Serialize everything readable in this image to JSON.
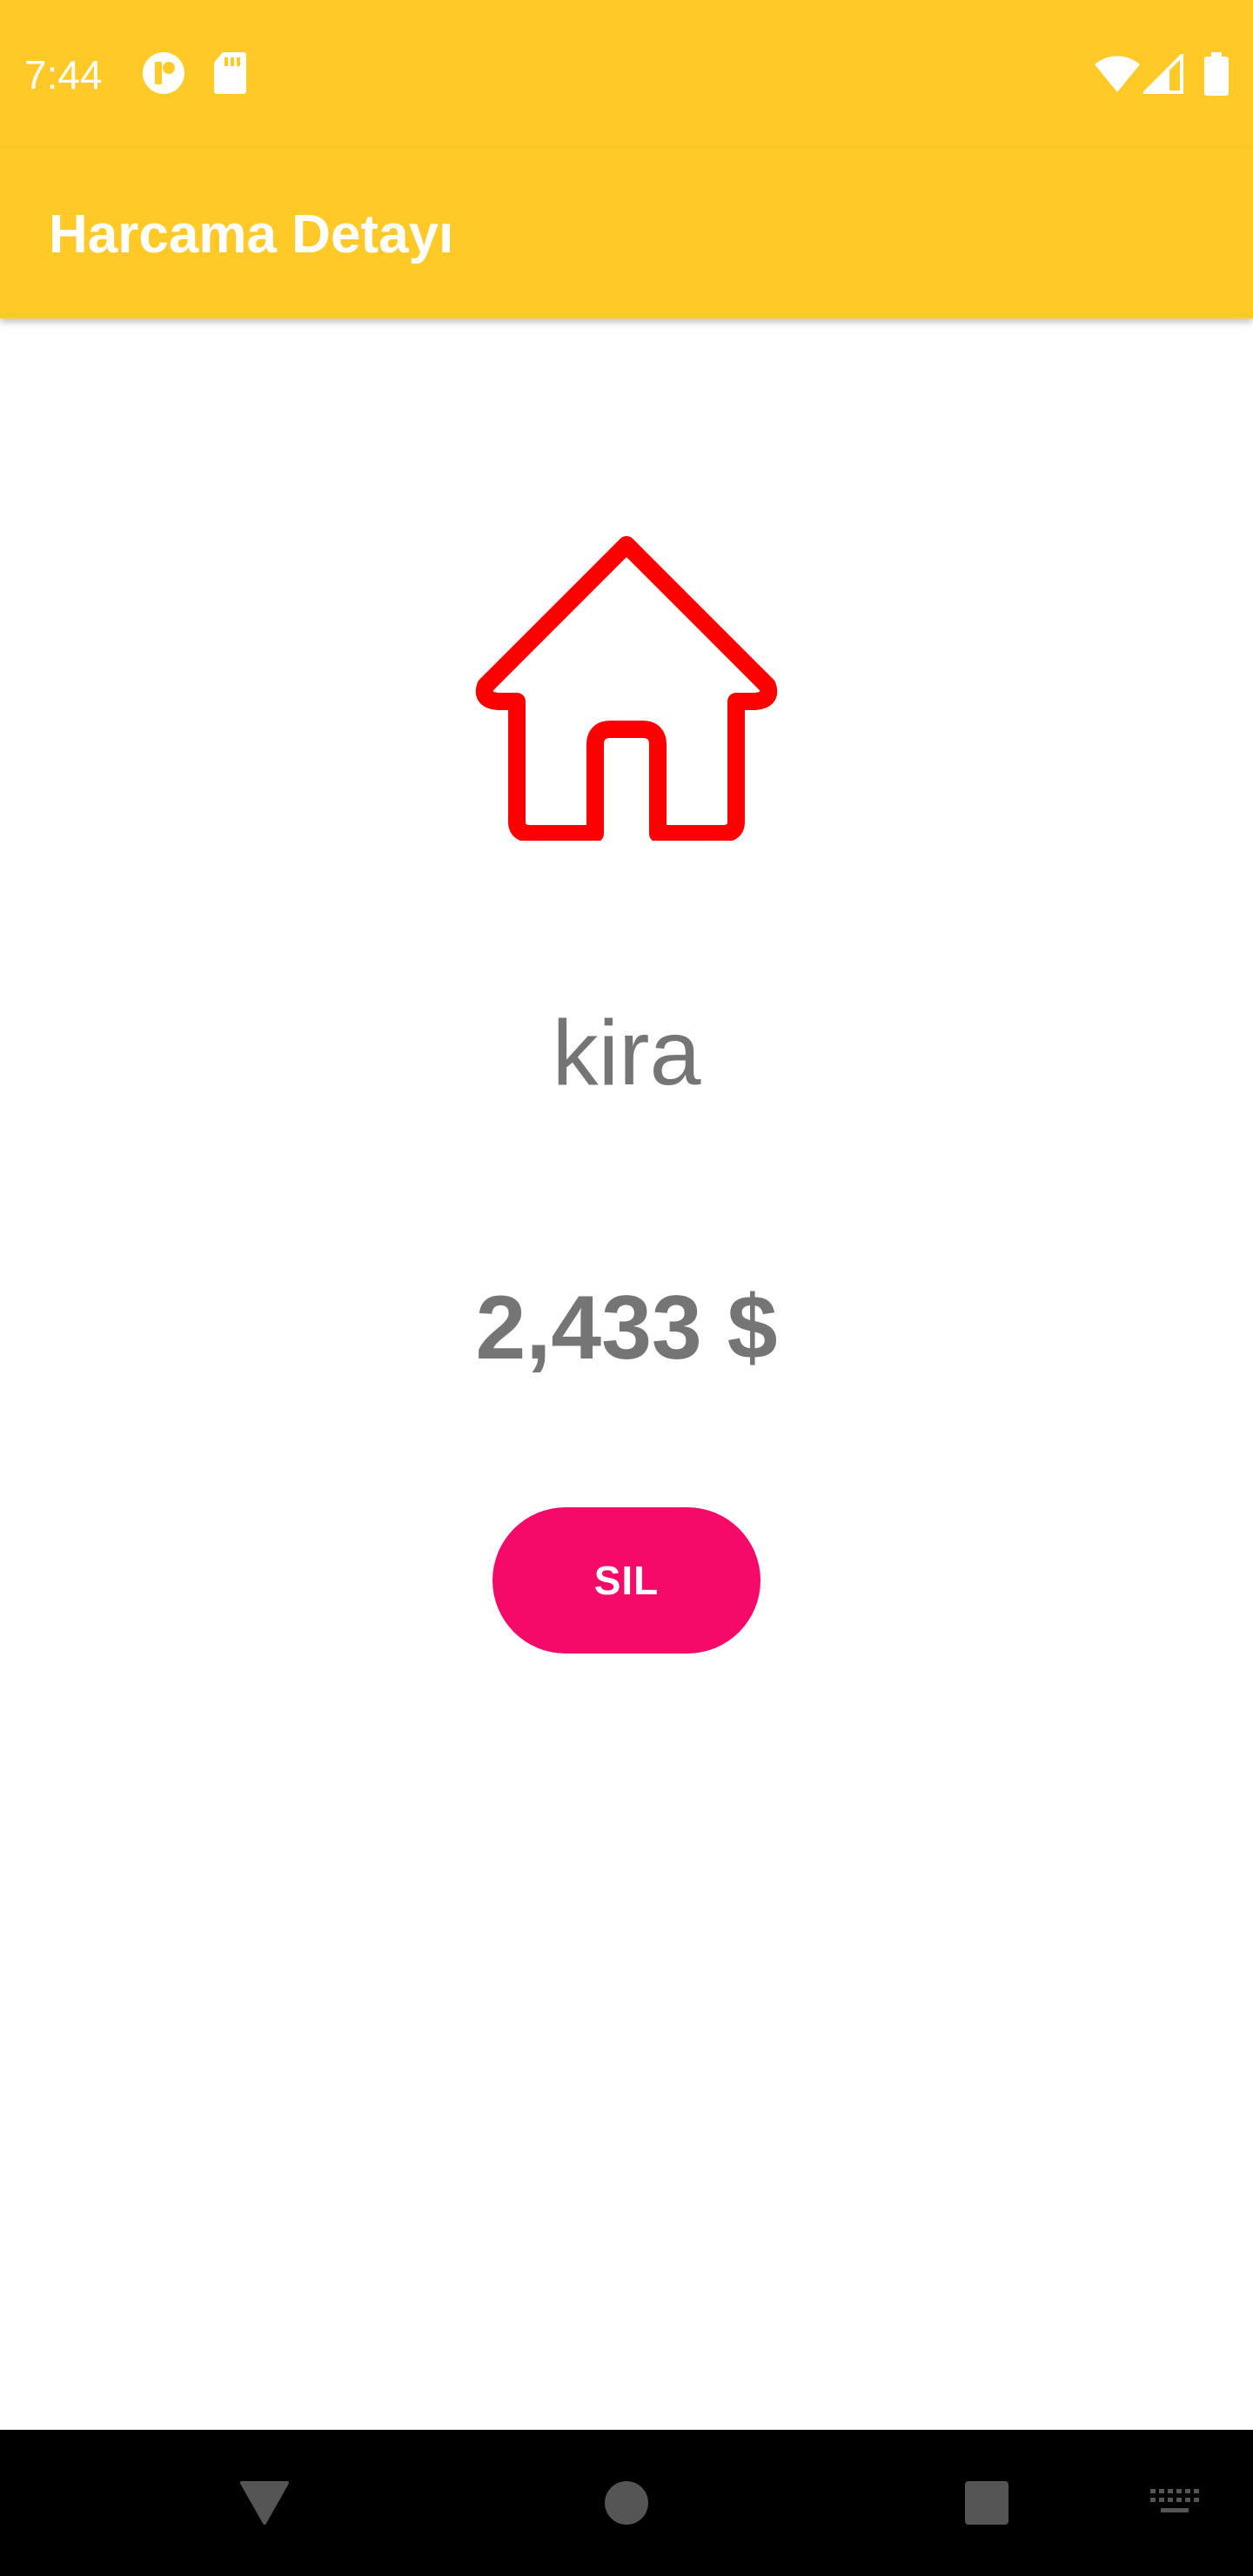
{
  "status_bar": {
    "time": "7:44",
    "icons": [
      "notification-app-icon",
      "sd-card-icon",
      "wifi-icon",
      "cell-signal-icon",
      "battery-icon"
    ]
  },
  "app_bar": {
    "title": "Harcama Detayı"
  },
  "expense": {
    "category_icon": "house-icon",
    "name": "kira",
    "amount": "2,433 $"
  },
  "actions": {
    "delete_label": "SIL"
  },
  "nav_bar": {
    "icons": [
      "back-icon",
      "home-icon",
      "recents-icon",
      "keyboard-icon"
    ]
  },
  "colors": {
    "primary": "#ffca28",
    "accent": "#f50a6a",
    "icon_red": "#ff0000",
    "text_gray": "#757575"
  }
}
